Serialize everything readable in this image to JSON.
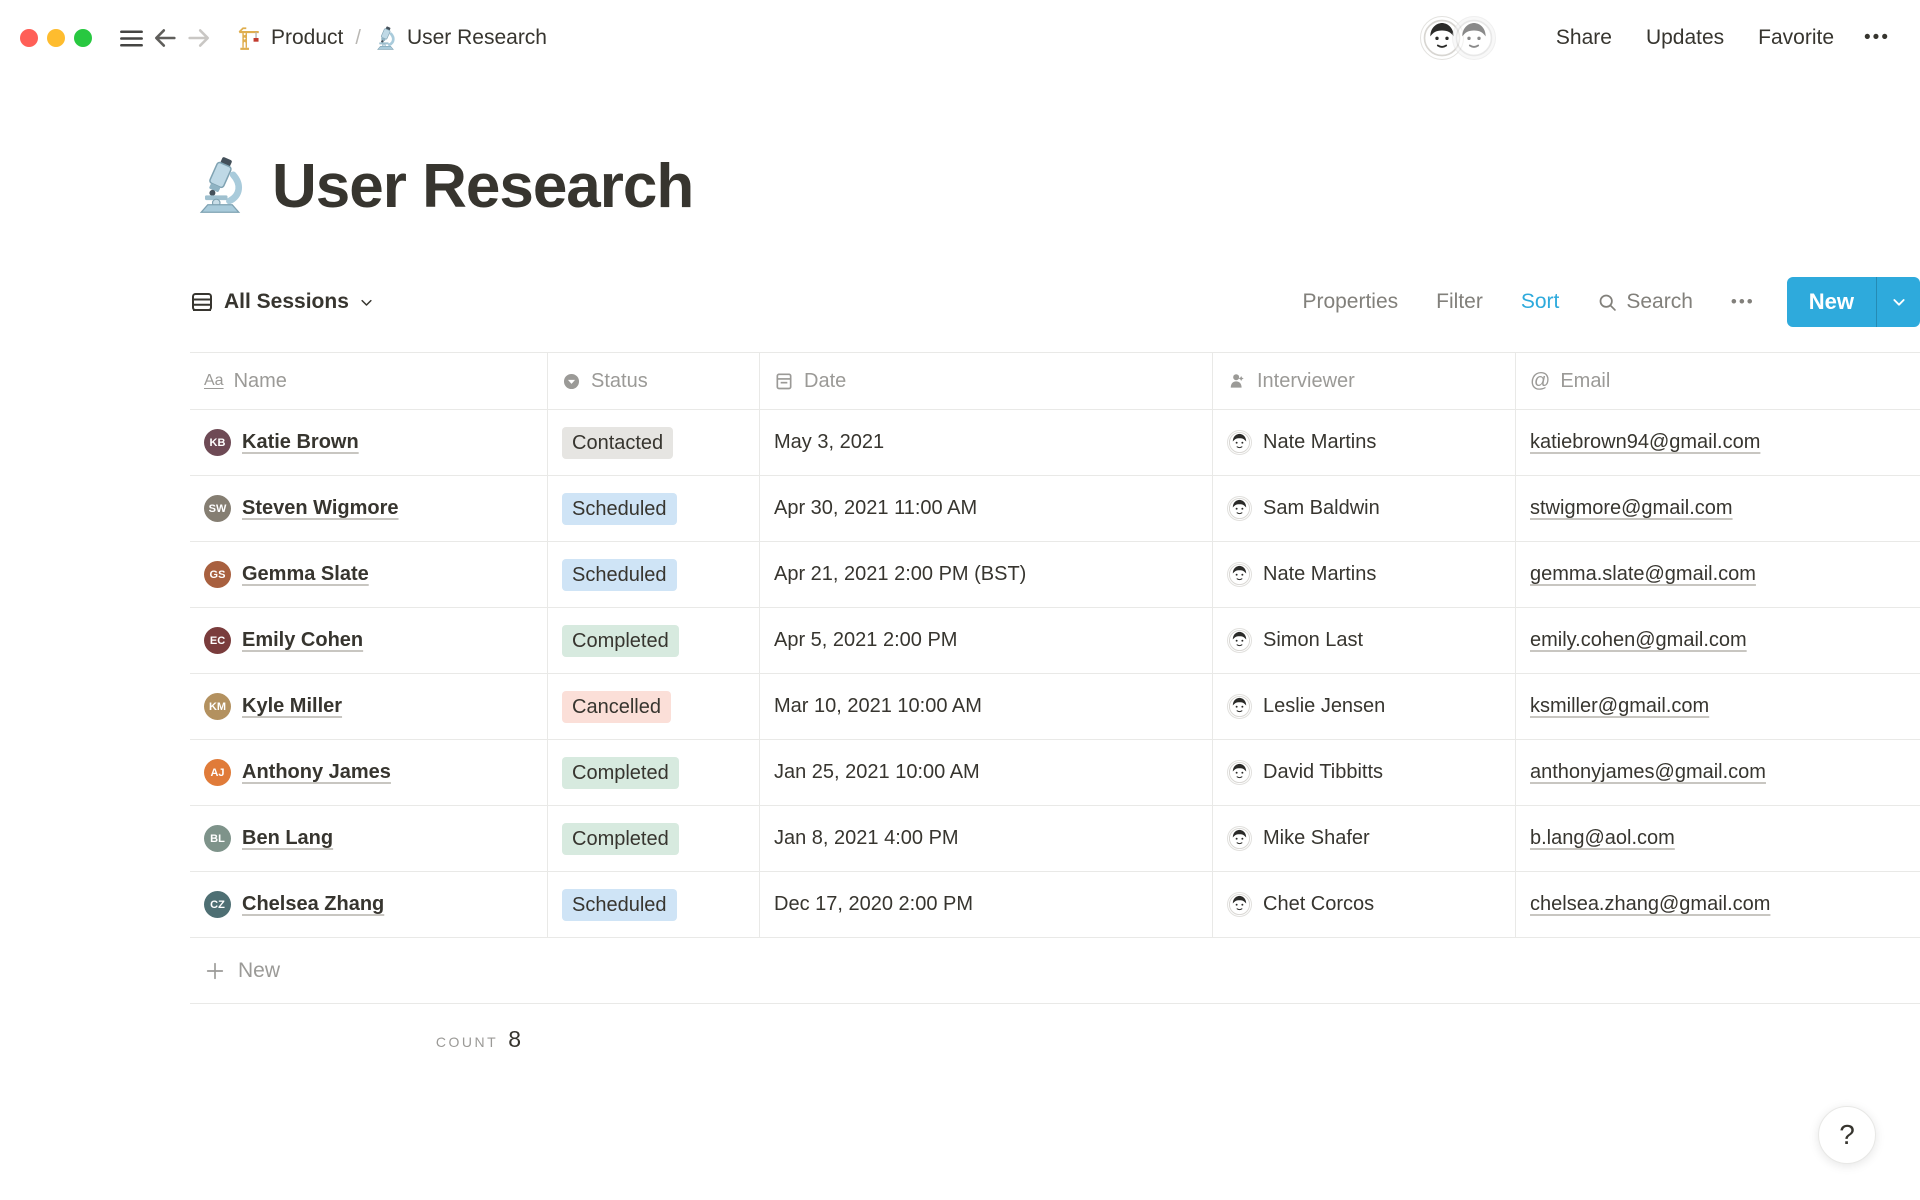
{
  "window": {
    "traffic_lights": [
      "#FF5F57",
      "#FEBC2E",
      "#28C840"
    ]
  },
  "topbar": {
    "breadcrumb": {
      "root_label": "Product",
      "separator": "/",
      "current_label": "User Research"
    },
    "actions": {
      "share": "Share",
      "updates": "Updates",
      "favorite": "Favorite",
      "more": "•••"
    }
  },
  "page": {
    "title": "User Research"
  },
  "toolbar": {
    "view_label": "All Sessions",
    "properties_label": "Properties",
    "filter_label": "Filter",
    "sort_label": "Sort",
    "search_label": "Search",
    "more": "•••",
    "new_label": "New",
    "accent_color": "#2EAADC"
  },
  "table": {
    "columns": [
      {
        "label": "Name"
      },
      {
        "label": "Status"
      },
      {
        "label": "Date"
      },
      {
        "label": "Interviewer"
      },
      {
        "label": "Email"
      }
    ],
    "status_colors": {
      "Contacted": "#E6E5E2",
      "Scheduled": "#CFE4F6",
      "Completed": "#D7EADF",
      "Cancelled": "#FBDFD8"
    },
    "rows": [
      {
        "name": "Katie Brown",
        "initials": "KB",
        "avatar_color": "#6E4A55",
        "status": "Contacted",
        "date": "May 3, 2021",
        "interviewer": "Nate Martins",
        "email": "katiebrown94@gmail.com"
      },
      {
        "name": "Steven Wigmore",
        "initials": "SW",
        "avatar_color": "#857E72",
        "status": "Scheduled",
        "date": "Apr 30, 2021 11:00 AM",
        "interviewer": "Sam Baldwin",
        "email": "stwigmore@gmail.com"
      },
      {
        "name": "Gemma Slate",
        "initials": "GS",
        "avatar_color": "#A8603F",
        "status": "Scheduled",
        "date": "Apr 21, 2021 2:00 PM (BST)",
        "interviewer": "Nate Martins",
        "email": "gemma.slate@gmail.com"
      },
      {
        "name": "Emily Cohen",
        "initials": "EC",
        "avatar_color": "#7A3C3C",
        "status": "Completed",
        "date": "Apr 5, 2021 2:00 PM",
        "interviewer": "Simon Last",
        "email": "emily.cohen@gmail.com"
      },
      {
        "name": "Kyle Miller",
        "initials": "KM",
        "avatar_color": "#B3915F",
        "status": "Cancelled",
        "date": "Mar 10, 2021 10:00 AM",
        "interviewer": "Leslie Jensen",
        "email": "ksmiller@gmail.com"
      },
      {
        "name": "Anthony James",
        "initials": "AJ",
        "avatar_color": "#E07B39",
        "status": "Completed",
        "date": "Jan 25, 2021 10:00 AM",
        "interviewer": "David Tibbitts",
        "email": "anthonyjames@gmail.com"
      },
      {
        "name": "Ben Lang",
        "initials": "BL",
        "avatar_color": "#7E938A",
        "status": "Completed",
        "date": "Jan 8, 2021 4:00 PM",
        "interviewer": "Mike Shafer",
        "email": "b.lang@aol.com"
      },
      {
        "name": "Chelsea Zhang",
        "initials": "CZ",
        "avatar_color": "#4E6F73",
        "status": "Scheduled",
        "date": "Dec 17, 2020 2:00 PM",
        "interviewer": "Chet Corcos",
        "email": "chelsea.zhang@gmail.com"
      }
    ]
  },
  "footer": {
    "new_label": "New",
    "count_label": "COUNT",
    "count_value": "8"
  },
  "help": {
    "label": "?"
  }
}
